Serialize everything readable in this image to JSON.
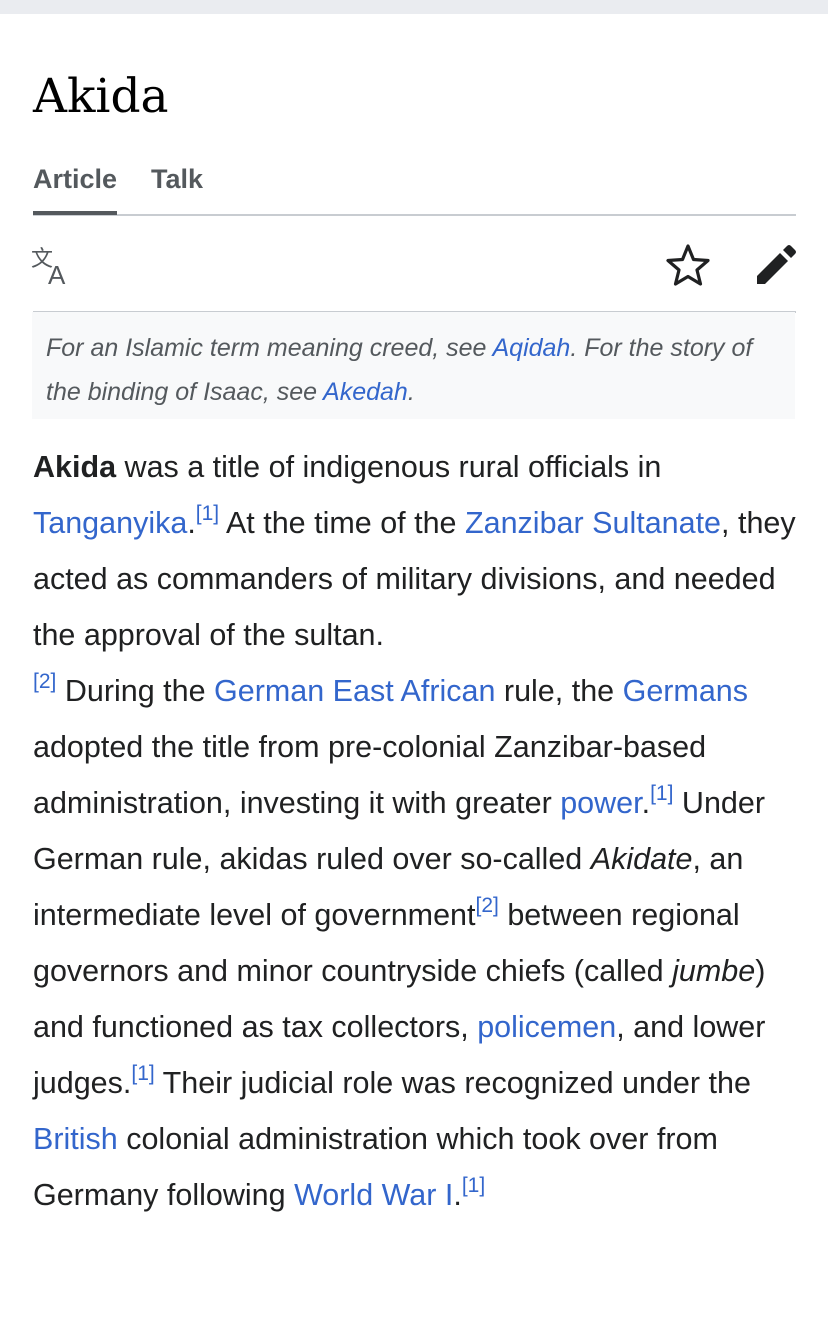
{
  "page": {
    "title": "Akida"
  },
  "tabs": [
    {
      "label": "Article"
    },
    {
      "label": "Talk"
    }
  ],
  "toolbar": {
    "language_icon": "language-icon",
    "watch_icon": "star-icon",
    "edit_icon": "pencil-icon"
  },
  "hatnote": {
    "t1": "For an Islamic term meaning creed, see ",
    "link1": "Aqidah",
    "t2": ". For the story of the binding of Isaac, see ",
    "link2": "Akedah",
    "t3": "."
  },
  "article": {
    "bold": "Akida",
    "s1": " was a title of indigenous rural officials in ",
    "l_tanganyika": "Tanganyika",
    "s2": ".",
    "ref1a": "[1]",
    "s3": " At the time of the ",
    "l_zanzibar": "Zanzibar Sultanate",
    "s4": ", they acted as commanders of military divisions, and needed the approval of the sultan.",
    "ref2a": "[2]",
    "s5": " During the ",
    "l_gea": "German East African",
    "s6": " rule, the ",
    "l_germans": "Germans",
    "s7": " adopted the title from pre-colonial Zanzibar-based administration, investing it with greater ",
    "l_power": "power",
    "s8": ".",
    "ref1b": "[1]",
    "s9": " Under German rule, akidas ruled over so-called ",
    "i_akidate": "Akidate",
    "s10": ", an intermediate level of government",
    "ref2b": "[2]",
    "s11": " between regional governors and minor countryside chiefs (called ",
    "i_jumbe": "jumbe",
    "s12": ") and functioned as tax collectors, ",
    "l_policemen": "policemen",
    "s13": ", and lower judges.",
    "ref1c": "[1]",
    "s14": " Their judicial role was recognized under the ",
    "l_british": "British",
    "s15": " colonial administration which took over from Germany following ",
    "l_ww1": "World War I",
    "s16": ".",
    "ref1d": "[1]"
  },
  "colors": {
    "link": "#3366cc",
    "text": "#202122",
    "muted": "#54595d",
    "border": "#c8ccd1",
    "hatnote_bg": "#f8f9fa"
  }
}
